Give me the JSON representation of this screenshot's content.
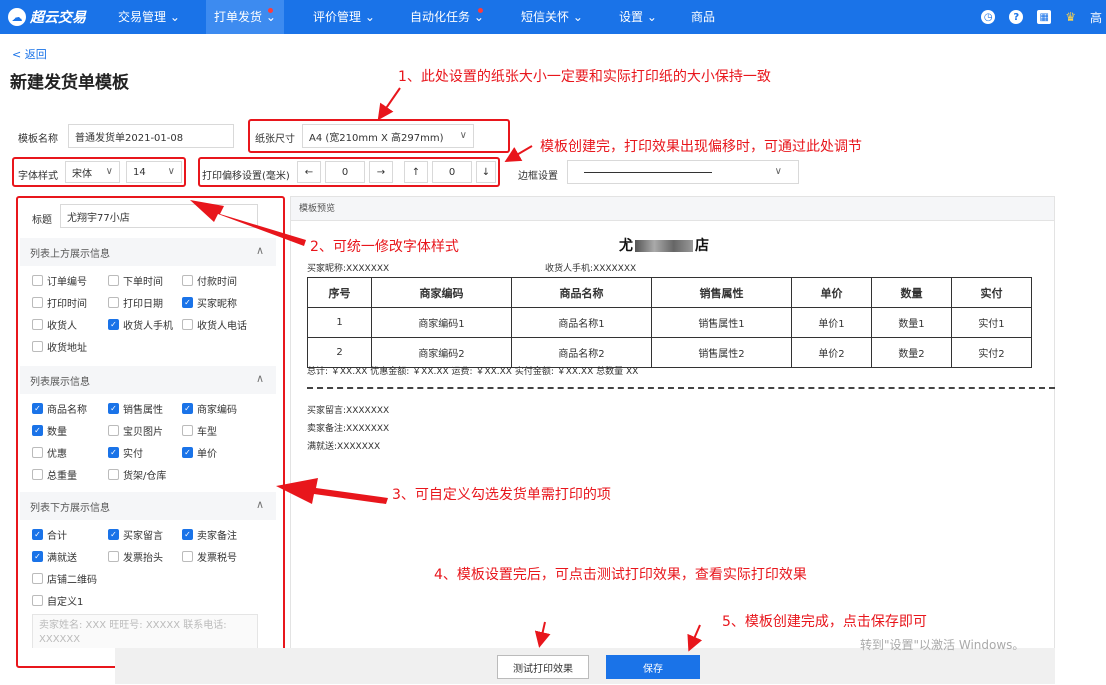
{
  "nav": {
    "logo": "超云交易",
    "items": [
      {
        "label": "交易管理 ⌄"
      },
      {
        "label": "打单发货"
      },
      {
        "label": "评价管理 ⌄"
      },
      {
        "label": "自动化任务"
      },
      {
        "label": "短信关怀 ⌄"
      },
      {
        "label": "设置 ⌄"
      },
      {
        "label": "商品"
      }
    ],
    "right_text": "高"
  },
  "page": {
    "back": "< 返回",
    "title": "新建发货单模板"
  },
  "form": {
    "name_label": "模板名称",
    "name_value": "普通发货单2021-01-08",
    "paper_label": "纸张尺寸",
    "paper_value": "A4 (宽210mm X 高297mm)",
    "font_label": "字体样式",
    "font_family": "宋体",
    "font_size": "14",
    "offset_label": "打印偏移设置(毫米)",
    "left_arrow": "←",
    "x_offset": "0",
    "right_arrow": "→",
    "up_arrow": "↑",
    "y_offset": "0",
    "down_arrow": "↓",
    "border_label": "边框设置"
  },
  "left": {
    "title_label": "标题",
    "title_value": "尤翔宇77小店",
    "sections": [
      {
        "title": "列表上方展示信息",
        "items": [
          {
            "label": "订单编号",
            "checked": false
          },
          {
            "label": "下单时间",
            "checked": false
          },
          {
            "label": "付款时间",
            "checked": false
          },
          {
            "label": "打印时间",
            "checked": false
          },
          {
            "label": "打印日期",
            "checked": false
          },
          {
            "label": "买家昵称",
            "checked": true
          },
          {
            "label": "收货人",
            "checked": false
          },
          {
            "label": "收货人手机",
            "checked": true
          },
          {
            "label": "收货人电话",
            "checked": false
          },
          {
            "label": "收货地址",
            "checked": false
          }
        ]
      },
      {
        "title": "列表展示信息",
        "items": [
          {
            "label": "商品名称",
            "checked": true
          },
          {
            "label": "销售属性",
            "checked": true
          },
          {
            "label": "商家编码",
            "checked": true
          },
          {
            "label": "数量",
            "checked": true
          },
          {
            "label": "宝贝图片",
            "checked": false
          },
          {
            "label": "车型",
            "checked": false
          },
          {
            "label": "优惠",
            "checked": false
          },
          {
            "label": "实付",
            "checked": true
          },
          {
            "label": "单价",
            "checked": true
          },
          {
            "label": "总重量",
            "checked": false
          },
          {
            "label": "货架/仓库",
            "checked": false
          }
        ]
      },
      {
        "title": "列表下方展示信息",
        "items": [
          {
            "label": "合计",
            "checked": true
          },
          {
            "label": "买家留言",
            "checked": true
          },
          {
            "label": "卖家备注",
            "checked": true
          },
          {
            "label": "满就送",
            "checked": true
          },
          {
            "label": "发票抬头",
            "checked": false
          },
          {
            "label": "发票税号",
            "checked": false
          },
          {
            "label": "店铺二维码",
            "checked": false
          },
          {
            "label": "自定义1",
            "checked": false
          }
        ]
      }
    ],
    "seller_placeholder": "卖家姓名: XXX 旺旺号: XXXXX 联系电话: XXXXXX"
  },
  "preview": {
    "header": "模板预览",
    "shop_prefix": "尤",
    "shop_suffix": "店",
    "buyer_nick": "买家昵称:XXXXXXX",
    "receiver_phone": "收货人手机:XXXXXXX",
    "columns": [
      "序号",
      "商家编码",
      "商品名称",
      "销售属性",
      "单价",
      "数量",
      "实付"
    ],
    "rows": [
      [
        "1",
        "商家编码1",
        "商品名称1",
        "销售属性1",
        "单价1",
        "数量1",
        "实付1"
      ],
      [
        "2",
        "商家编码2",
        "商品名称2",
        "销售属性2",
        "单价2",
        "数量2",
        "实付2"
      ]
    ],
    "totals": "总计: ￥XX.XX 优惠金额: ￥XX.XX 运费: ￥XX.XX 实付金额: ￥XX.XX 总数量 XX",
    "buyer_msg": "买家留言:XXXXXXX",
    "seller_note": "卖家备注:XXXXXXX",
    "gift": "满就送:XXXXXXX"
  },
  "annotations": {
    "a1": "1、此处设置的纸张大小一定要和实际打印纸的大小保持一致",
    "a_offset": "模板创建完，打印效果出现偏移时，可通过此处调节",
    "a2": "2、可统一修改字体样式",
    "a3": "3、可自定义勾选发货单需打印的项",
    "a4": "4、模板设置完后，可点击测试打印效果，查看实际打印效果",
    "a5": "5、模板创建完成，点击保存即可"
  },
  "buttons": {
    "test": "测试打印效果",
    "save": "保存"
  },
  "watermark": "转到\"设置\"以激活 Windows。",
  "colors": {
    "primary": "#1a73e8",
    "annotation": "#e8161c"
  }
}
